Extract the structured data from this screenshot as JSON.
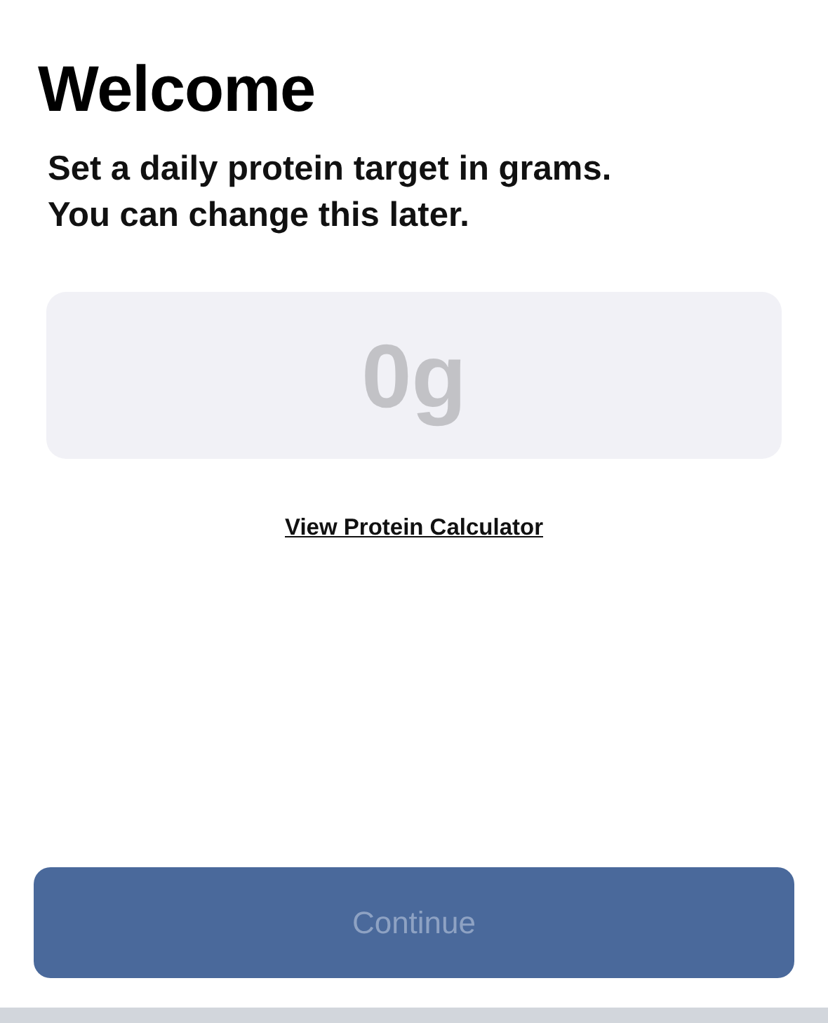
{
  "title": "Welcome",
  "subtitle": "Set a daily protein target in grams.\nYou can change this later.",
  "target_field": {
    "placeholder": "0g"
  },
  "calculator_link": "View Protein Calculator",
  "continue_button": {
    "label": "Continue",
    "disabled": true
  }
}
